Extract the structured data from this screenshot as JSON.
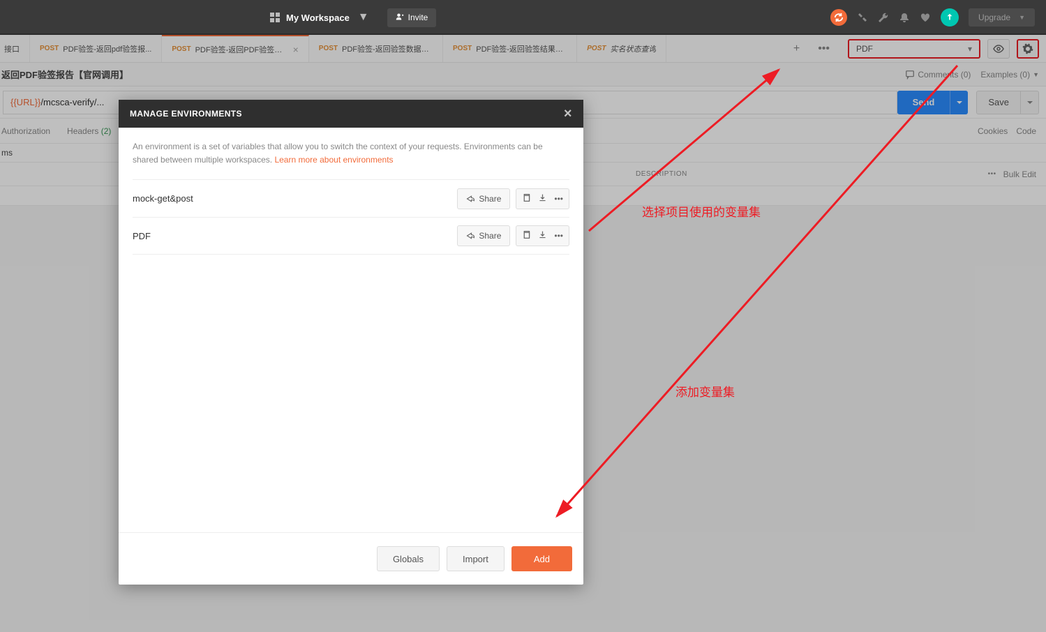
{
  "topbar": {
    "workspace_label": "My Workspace",
    "invite_label": "Invite",
    "upgrade_label": "Upgrade"
  },
  "tabs": [
    {
      "method": "",
      "name": "接口",
      "italic": false
    },
    {
      "method": "POST",
      "name": "PDF验签-返回pdf验签报...",
      "italic": false
    },
    {
      "method": "POST",
      "name": "PDF验签-返回PDF验签报...",
      "italic": false,
      "active": true,
      "closable": true
    },
    {
      "method": "POST",
      "name": "PDF验签-返回验签数据【...",
      "italic": false
    },
    {
      "method": "POST",
      "name": "PDF验签-返回验签结果数据",
      "italic": false
    },
    {
      "method": "POST",
      "name": "实名状态查询",
      "italic": true
    }
  ],
  "env_dropdown": {
    "selected": "PDF"
  },
  "request": {
    "title": "返回PDF验签报告【官网调用】",
    "comments_label": "Comments (0)",
    "examples_label": "Examples (0)",
    "url_var": "{{URL}}",
    "url_path": "/mcsca-verify/...",
    "send_label": "Send",
    "save_label": "Save"
  },
  "req_tabs": {
    "authorization": "Authorization",
    "headers": "Headers",
    "headers_count": "(2)",
    "cookies": "Cookies",
    "code": "Code"
  },
  "params_label": "ms",
  "grid": {
    "desc_col": "DESCRIPTION",
    "bulk_label": "Bulk Edit"
  },
  "modal": {
    "title": "MANAGE ENVIRONMENTS",
    "desc_a": "An environment is a set of variables that allow you to switch the context of your requests. Environments can be shared between multiple workspaces. ",
    "desc_link": "Learn more about environments",
    "environments": [
      {
        "name": "mock-get&post",
        "share": "Share"
      },
      {
        "name": "PDF",
        "share": "Share"
      }
    ],
    "globals_label": "Globals",
    "import_label": "Import",
    "add_label": "Add"
  },
  "annotations": {
    "a1": "选择项目使用的变量集",
    "a2": "添加变量集"
  }
}
